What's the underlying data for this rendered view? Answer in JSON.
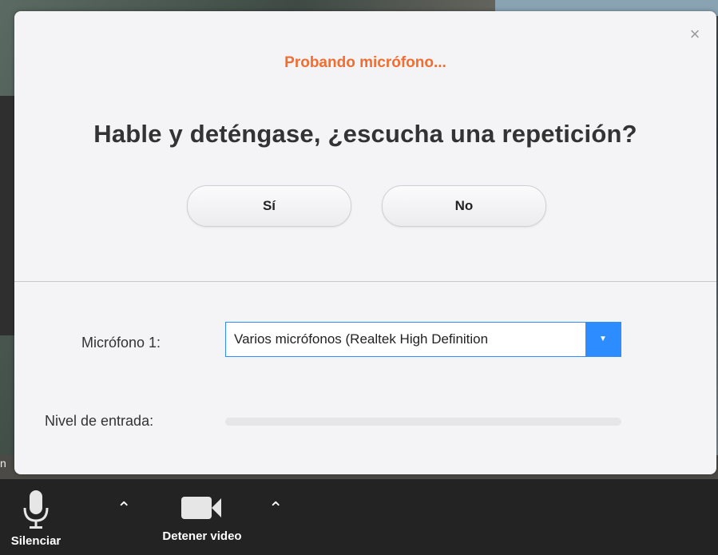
{
  "dialog": {
    "subtitle": "Probando micrófono...",
    "headline": "Hable y deténgase, ¿escucha una repetición?",
    "yes_label": "Sí",
    "no_label": "No",
    "close_icon": "×"
  },
  "mic": {
    "label": "Micrófono 1:",
    "selected": "Varios micrófonos (Realtek High Definition",
    "dropdown_icon": "▼"
  },
  "level": {
    "label": "Nivel de entrada:",
    "value": 0
  },
  "toolbar": {
    "mute_label": "Silenciar",
    "video_label": "Detener video",
    "caret": "⌃"
  },
  "background": {
    "edge_text": "n"
  },
  "colors": {
    "accent": "#2d8cff",
    "subtitle": "#f26d2f"
  }
}
